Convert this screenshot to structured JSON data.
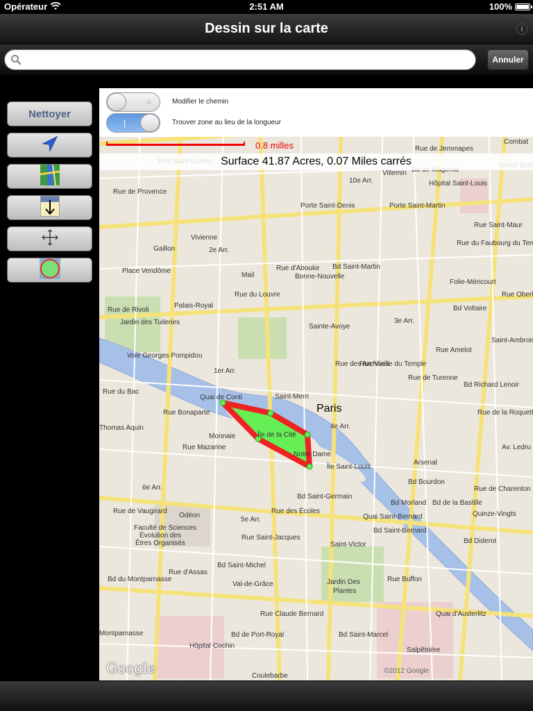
{
  "status_bar": {
    "carrier": "Opérateur",
    "time": "2:51 AM",
    "battery": "100%",
    "battery_level": 1.0
  },
  "nav": {
    "title": "Dessin sur la carte"
  },
  "search": {
    "value": "",
    "placeholder": "",
    "cancel_label": "Annuler"
  },
  "tools": {
    "clear_label": "Nettoyer",
    "items": [
      {
        "name": "clear-button"
      },
      {
        "name": "locate-button",
        "icon": "location-arrow-icon"
      },
      {
        "name": "map-type-button",
        "icon": "map-type-icon"
      },
      {
        "name": "drop-pin-button",
        "icon": "drop-down-arrow-icon"
      },
      {
        "name": "pan-button",
        "icon": "move-arrows-icon"
      },
      {
        "name": "fill-area-button",
        "icon": "green-circle-icon"
      }
    ]
  },
  "toggles": {
    "modify_path": {
      "label": "Modifier le chemin",
      "on": false
    },
    "find_area": {
      "label": "Trouver zone au lieu de la longueur",
      "on": true
    }
  },
  "scale": {
    "label": "0.8 milles"
  },
  "surface": {
    "text": "Surface 41.87 Acres, 0.07 Miles carrés"
  },
  "map": {
    "copyright": "©2012 Google",
    "logo": "Google",
    "polygon_fill": "#66ee55",
    "polygon_stroke": "#ee2222",
    "labels": [
      "Combat",
      "Rue Saint-Lazare",
      "Simon Bolivar",
      "Villemin",
      "10e Arr.",
      "Rue de Provence",
      "Porte Saint-Denis",
      "Hôpital Saint-Louis",
      "Porte Saint-Martin",
      "Vivienne",
      "2e Arr.",
      "Gaillon",
      "Rue d'Aboukir",
      "Bd Saint-Martin",
      "Place Vendôme",
      "Mail",
      "Bonne-Nouvelle",
      "Folie-Méricourt",
      "Palais-Royal",
      "Rue du Louvre",
      "Jardin des Tuileries",
      "Rue de Rivoli",
      "Sainte-Avoye",
      "3e Arr.",
      "Saint-Ambroise",
      "Voie Georges Pompidou",
      "1er Arr.",
      "Saint-Merri",
      "Paris",
      "4e Arr.",
      "Quai de Conti",
      "Rue du Bac",
      "Rue Bonaparte",
      "Thomas Aquin",
      "Monnaie",
      "Île de la Cité",
      "Notre Dame",
      "Île Saint-Louis",
      "Arsenal",
      "6e Arr.",
      "Bd Saint-Germain",
      "Rue de Vaugirard",
      "Odéon",
      "5e Arr.",
      "Rue des Écoles",
      "Quinze-Vingts",
      "Faculté de Sciences",
      "Évolution des",
      "Êtres Organisés",
      "Saint-Victor",
      "Bd Diderot",
      "Val-de-Grâce",
      "Jardin Des",
      "Plantes",
      "Rue Buffon",
      "Bd du Montparnasse",
      "Rue Claude Bernard",
      "Bd de Port-Royal",
      "Bd Saint-Marcel",
      "Montparnasse",
      "Hôpital Cochin",
      "Salpêtrière",
      "Coulebarbe",
      "Rue de la Roquette",
      "Bd Voltaire",
      "Rue de Turenne",
      "Bd Richard Lenoir",
      "Rue de Charenton",
      "Bd de la Bastille",
      "Quai d'Austerlitz",
      "Rue Oberkampf",
      "Bd Saint-Michel",
      "Rue Saint-Jacques",
      "Rue Mazarine",
      "Rue Vieille du Temple",
      "Rue des Archives",
      "Rue du Faubourg du Temple",
      "Bd de Magenta",
      "Bd Bourdon",
      "Bd Morland",
      "Bd Saint-Bernard",
      "Quai Saint-Bernard",
      "Av. Ledru Rollin",
      "Rue d'Assas",
      "Rue de Jemmapes",
      "Rue Saint-Maur",
      "Rue Amelot"
    ]
  }
}
